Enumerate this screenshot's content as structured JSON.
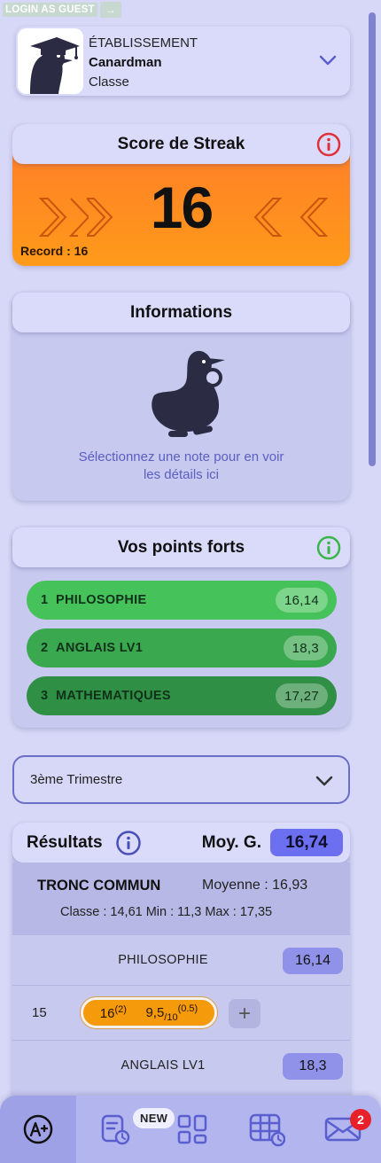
{
  "guest": {
    "login_label": "LOGIN AS GUEST",
    "arrow": "→"
  },
  "etablissement": {
    "label": "ÉTABLISSEMENT",
    "name": "Canardman",
    "classe": "Classe"
  },
  "streak": {
    "title": "Score de Streak",
    "value": "16",
    "record": "Record : 16"
  },
  "informations": {
    "title": "Informations",
    "message_line1": "Sélectionnez une note pour en voir",
    "message_line2": "les détails ici"
  },
  "points_forts": {
    "title": "Vos points forts",
    "items": [
      {
        "rank": "1",
        "subject": "PHILOSOPHIE",
        "value": "16,14",
        "color": "#45c25a"
      },
      {
        "rank": "2",
        "subject": "ANGLAIS LV1",
        "value": "18,3",
        "color": "#3aa84f"
      },
      {
        "rank": "3",
        "subject": "MATHEMATIQUES",
        "value": "17,27",
        "color": "#2f8f44"
      }
    ]
  },
  "trimestre": {
    "selected": "3ème Trimestre"
  },
  "resultats": {
    "title": "Résultats",
    "moy_label": "Moy. G.",
    "moy_value": "16,74",
    "tronc": {
      "title": "TRONC COMMUN",
      "moyenne": "Moyenne : 16,93",
      "stats": "Classe : 14,61   Min : 11,3   Max : 17,35"
    },
    "subjects": [
      {
        "name": "PHILOSOPHIE",
        "value": "16,14"
      },
      {
        "name": "ANGLAIS LV1",
        "value": "18,3"
      }
    ],
    "grades": {
      "coef": "15",
      "grade1": "16",
      "grade1_coef": "(2)",
      "grade2": "9,5",
      "grade2_den": "/10",
      "grade2_coef": "(0.5)",
      "add": "+"
    }
  },
  "nav": {
    "new_badge": "NEW",
    "mail_count": "2"
  },
  "colors": {
    "accent": "#6b6ff0",
    "streak_top": "#ff7a2a",
    "streak_bottom": "#ff9a1a",
    "info_red": "#e0303a",
    "info_green": "#3bb54a"
  }
}
